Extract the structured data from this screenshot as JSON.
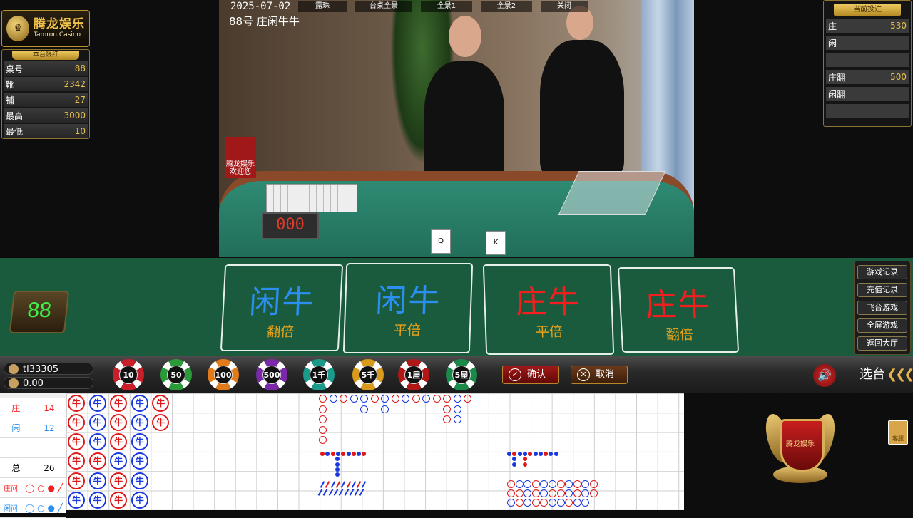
{
  "brand": {
    "name": "腾龙娱乐",
    "subtitle": "Tamron Casino"
  },
  "limits": {
    "title": "本台限红",
    "rows": [
      {
        "label": "桌号",
        "value": "88"
      },
      {
        "label": "靴",
        "value": "2342"
      },
      {
        "label": "铺",
        "value": "27"
      },
      {
        "label": "最高",
        "value": "3000"
      },
      {
        "label": "最低",
        "value": "10"
      }
    ]
  },
  "current_bets": {
    "title": "当前投注",
    "rows": [
      {
        "label": "庄",
        "value": "530"
      },
      {
        "label": "闲",
        "value": ""
      },
      {
        "label": "",
        "value": ""
      },
      {
        "label": "庄翻",
        "value": "500"
      },
      {
        "label": "闲翻",
        "value": ""
      },
      {
        "label": "",
        "value": ""
      }
    ]
  },
  "video": {
    "date": "2025-07-02",
    "round_label": "88号 庄闲牛牛",
    "buttons": [
      "露珠",
      "台桌全景",
      "全景1",
      "全景2",
      "关闭"
    ],
    "sign_text": "腾龙娱乐\n欢迎您",
    "timer": "000"
  },
  "table_number": "88",
  "bet_areas": [
    {
      "main": "闲牛",
      "sub": "翻倍",
      "color": "#2a8ff0"
    },
    {
      "main": "闲牛",
      "sub": "平倍",
      "color": "#2a8ff0"
    },
    {
      "main": "庄牛",
      "sub": "平倍",
      "color": "#f41e1e"
    },
    {
      "main": "庄牛",
      "sub": "翻倍",
      "color": "#f41e1e"
    }
  ],
  "side_links": [
    "游戏记录",
    "充值记录",
    "飞台游戏",
    "全屏游戏",
    "返回大厅"
  ],
  "account": {
    "username": "tl33305",
    "balance": "0.00"
  },
  "chips": [
    {
      "label": "10",
      "color": "#c8202a"
    },
    {
      "label": "50",
      "color": "#2a9a3a"
    },
    {
      "label": "100",
      "color": "#e07a1a"
    },
    {
      "label": "500",
      "color": "#7a2aa8"
    },
    {
      "label": "1千",
      "color": "#1a9a8a"
    },
    {
      "label": "5千",
      "color": "#d89a1a"
    },
    {
      "label": "1屋",
      "color": "#b01818"
    },
    {
      "label": "5屋",
      "color": "#1a8a4a"
    }
  ],
  "actions": {
    "confirm": "确认",
    "cancel": "取消"
  },
  "select_table": "选台",
  "stats": {
    "banker_label": "庄",
    "banker": "14",
    "player_label": "闲",
    "player": "12",
    "total_label": "总",
    "total": "26",
    "banker_ask": "庄问",
    "player_ask": "闲问"
  },
  "emblem_text": "腾龙娱乐",
  "mini_label": "客服",
  "bead_road": [
    [
      "z",
      "x",
      "z",
      "x",
      "z"
    ],
    [
      "z",
      "x",
      "z",
      "x",
      "z"
    ],
    [
      "z",
      "x",
      "z",
      "x"
    ],
    [
      "z",
      "z",
      "x",
      "x"
    ],
    [
      "z",
      "x",
      "z",
      "x"
    ],
    [
      "x",
      "x",
      "z",
      "x"
    ]
  ],
  "bead_labels": {
    "z": "牛",
    "x": "牛"
  }
}
